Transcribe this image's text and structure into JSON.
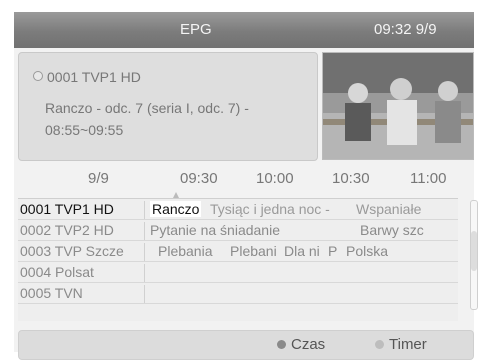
{
  "header": {
    "title": "EPG",
    "clock": "09:32 9/9"
  },
  "info": {
    "channel": "0001 TVP1 HD",
    "program_line1": "Ranczo - odc. 7 (seria I, odc. 7) -",
    "program_line2": "08:55~09:55"
  },
  "timeline": {
    "date": "9/9",
    "times": [
      "09:30",
      "10:00",
      "10:30",
      "11:00"
    ]
  },
  "channels": [
    {
      "name": "0001  TVP1 HD",
      "programs": [
        "Ranczo",
        "Tysiąc i jedna noc -",
        "Wspaniałe"
      ]
    },
    {
      "name": "0002  TVP2 HD",
      "programs": [
        "Pytanie na śniadanie",
        "Barwy szc"
      ]
    },
    {
      "name": "0003  TVP Szcze",
      "programs": [
        "Plebania",
        "Plebani",
        "Dla ni",
        "P",
        "Polska"
      ]
    },
    {
      "name": "0004  Polsat",
      "programs": []
    },
    {
      "name": "0005  TVN",
      "programs": []
    }
  ],
  "footer": {
    "czas_label": "Czas",
    "timer_label": "Timer",
    "czas_color": "#8a8a8a",
    "timer_color": "#bdbdbd"
  }
}
